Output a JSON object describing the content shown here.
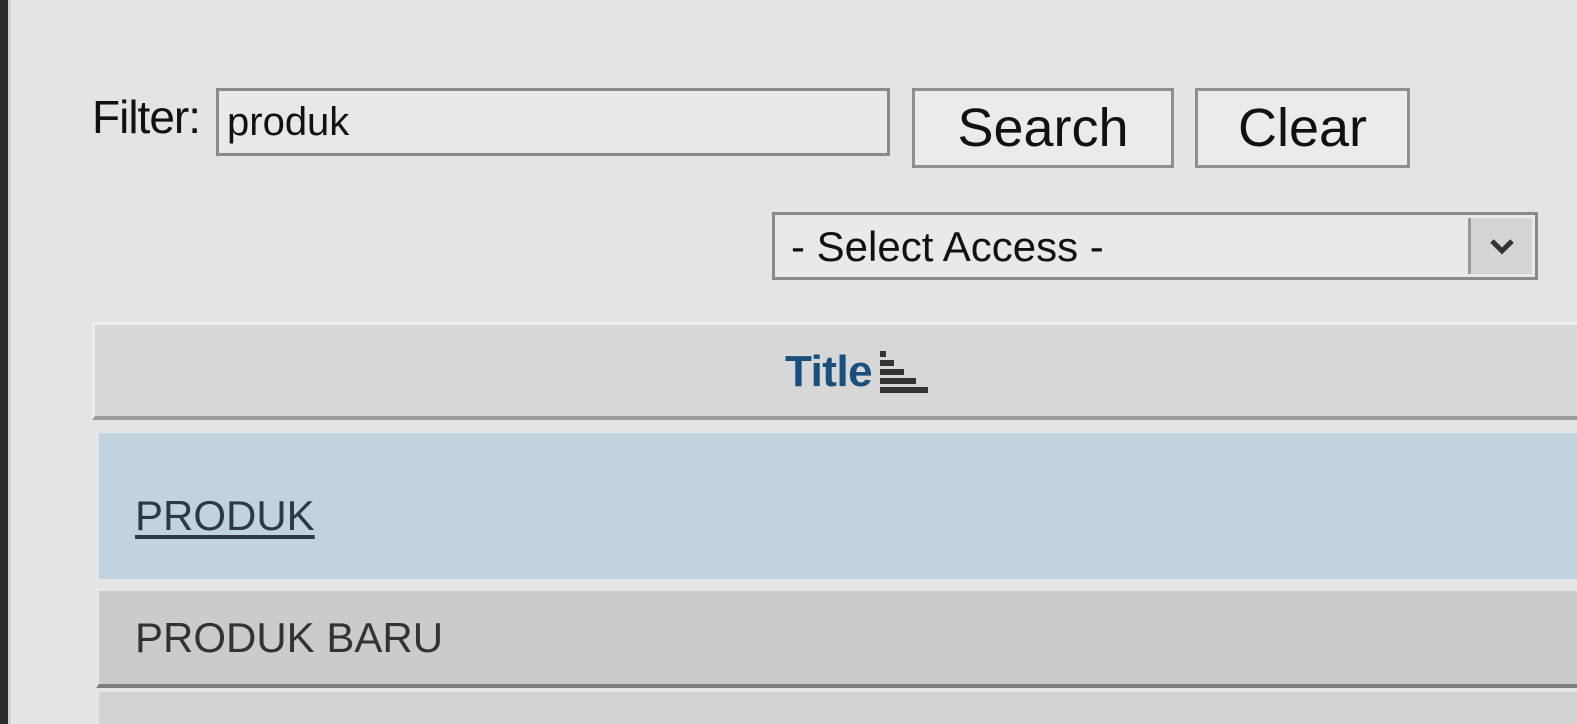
{
  "filter": {
    "label": "Filter:",
    "value": "produk"
  },
  "buttons": {
    "search_label": "Search",
    "clear_label": "Clear"
  },
  "access_select": {
    "selected": "- Select Access -"
  },
  "table": {
    "header_title": "Title",
    "sort_icon": "sort-ascending-icon",
    "header_color": "#184f7c",
    "selected_row_color": "#c2d3e0",
    "rows": [
      {
        "label": "PRODUK"
      },
      {
        "label": "PRODUK BARU"
      }
    ]
  }
}
